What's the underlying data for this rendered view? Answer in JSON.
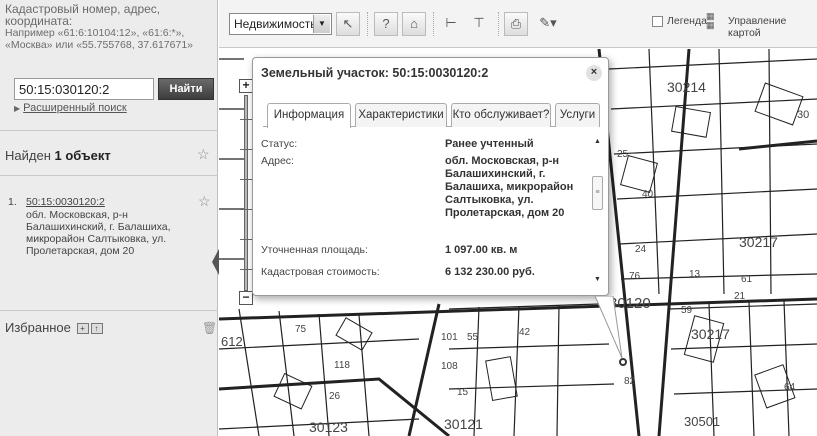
{
  "sidebar": {
    "hint_title": "Кадастровый номер, адрес, координата:",
    "hint_example": "Например «61:6:10104:12», «61:6:*», «Москва» или «55.755768, 37.617671»",
    "search_value": "50:15:030120:2",
    "find_label": "Найти",
    "advanced_label": "Расширенный поиск",
    "found_prefix": "Найден ",
    "found_count": "1 объект",
    "result": {
      "number": "1.",
      "link": "50:15:0030120:2",
      "address": "обл. Московская, р-н Балашихинский, г. Балашиха, микрорайон Салтыковка, ул. Пролетарская, дом 20"
    },
    "favorites_label": "Избранное"
  },
  "toolbar": {
    "layer_select": "Недвижимость",
    "legend_label": "Легенда",
    "manage_label": "Управление картой"
  },
  "popup": {
    "title": "Земельный участок: 50:15:0030120:2",
    "tabs": [
      {
        "label": "Информация"
      },
      {
        "label": "Характеристики"
      },
      {
        "label": "Кто обслуживает?"
      },
      {
        "label": "Услуги"
      }
    ],
    "rows": [
      {
        "key": "Статус:",
        "value": "Ранее учтенный"
      },
      {
        "key": "Адрес:",
        "value": "обл. Московская, р-н Балашихинский, г. Балашиха, микрорайон Салтыковка, ул. Пролетарская, дом 20"
      },
      {
        "key": "Уточненная площадь:",
        "value": "1 097.00 кв. м"
      },
      {
        "key": "Кадастровая стоимость:",
        "value": "6 132 230.00 руб."
      }
    ]
  },
  "map": {
    "labels": [
      "30214",
      "30",
      "25",
      "40",
      "30217",
      "24",
      "76",
      "13",
      "61",
      "21",
      "30120",
      "59",
      "30217",
      "82",
      "30501",
      "30123",
      "30121",
      "101",
      "55",
      "108",
      "42",
      "118",
      "26",
      "64",
      "15",
      "75",
      "612"
    ]
  }
}
